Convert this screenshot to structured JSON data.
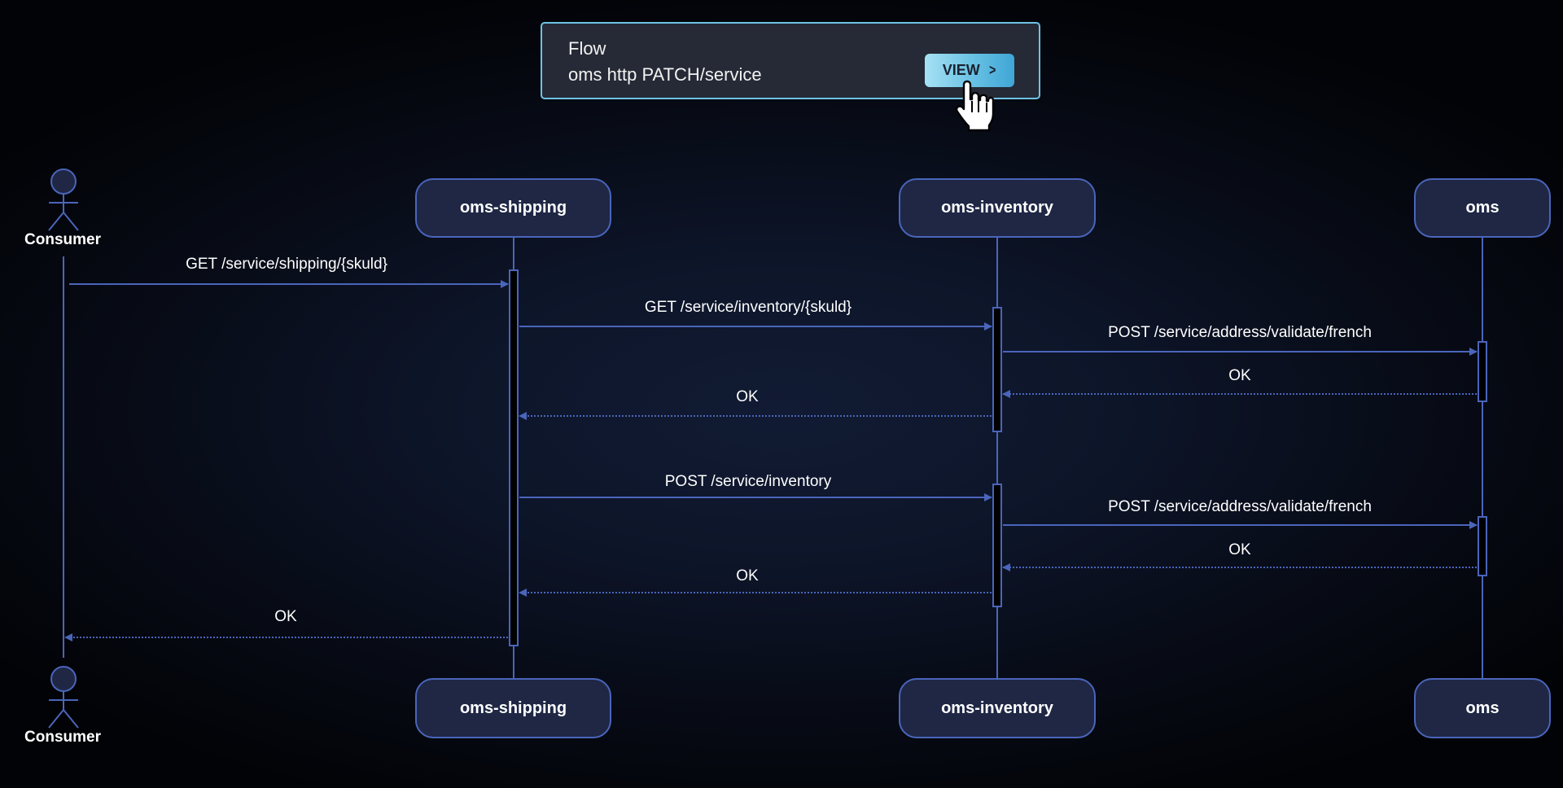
{
  "flow_card": {
    "title": "Flow",
    "subtitle": "oms http PATCH/service",
    "view_label": "VIEW",
    "view_icon": "chevron-right-icon",
    "border_color": "#6ec3e3"
  },
  "colors": {
    "line": "#4a65bb",
    "participant_fill": "#1f2745",
    "activation_fill": "#000000"
  },
  "actors": [
    {
      "id": "consumer",
      "label": "Consumer",
      "type": "actor"
    },
    {
      "id": "oms-shipping",
      "label": "oms-shipping",
      "type": "participant"
    },
    {
      "id": "oms-inventory",
      "label": "oms-inventory",
      "type": "participant"
    },
    {
      "id": "oms",
      "label": "oms",
      "type": "participant"
    }
  ],
  "messages": [
    {
      "from": "consumer",
      "to": "oms-shipping",
      "label": "GET /service/shipping/{skuld}",
      "kind": "call"
    },
    {
      "from": "oms-shipping",
      "to": "oms-inventory",
      "label": "GET /service/inventory/{skuld}",
      "kind": "call"
    },
    {
      "from": "oms-inventory",
      "to": "oms",
      "label": "POST /service/address/validate/french",
      "kind": "call"
    },
    {
      "from": "oms",
      "to": "oms-inventory",
      "label": "OK",
      "kind": "return"
    },
    {
      "from": "oms-inventory",
      "to": "oms-shipping",
      "label": "OK",
      "kind": "return"
    },
    {
      "from": "oms-shipping",
      "to": "oms-inventory",
      "label": "POST /service/inventory",
      "kind": "call"
    },
    {
      "from": "oms-inventory",
      "to": "oms",
      "label": "POST /service/address/validate/french",
      "kind": "call"
    },
    {
      "from": "oms",
      "to": "oms-inventory",
      "label": "OK",
      "kind": "return"
    },
    {
      "from": "oms-inventory",
      "to": "oms-shipping",
      "label": "OK",
      "kind": "return"
    },
    {
      "from": "oms-shipping",
      "to": "consumer",
      "label": "OK",
      "kind": "return"
    }
  ]
}
